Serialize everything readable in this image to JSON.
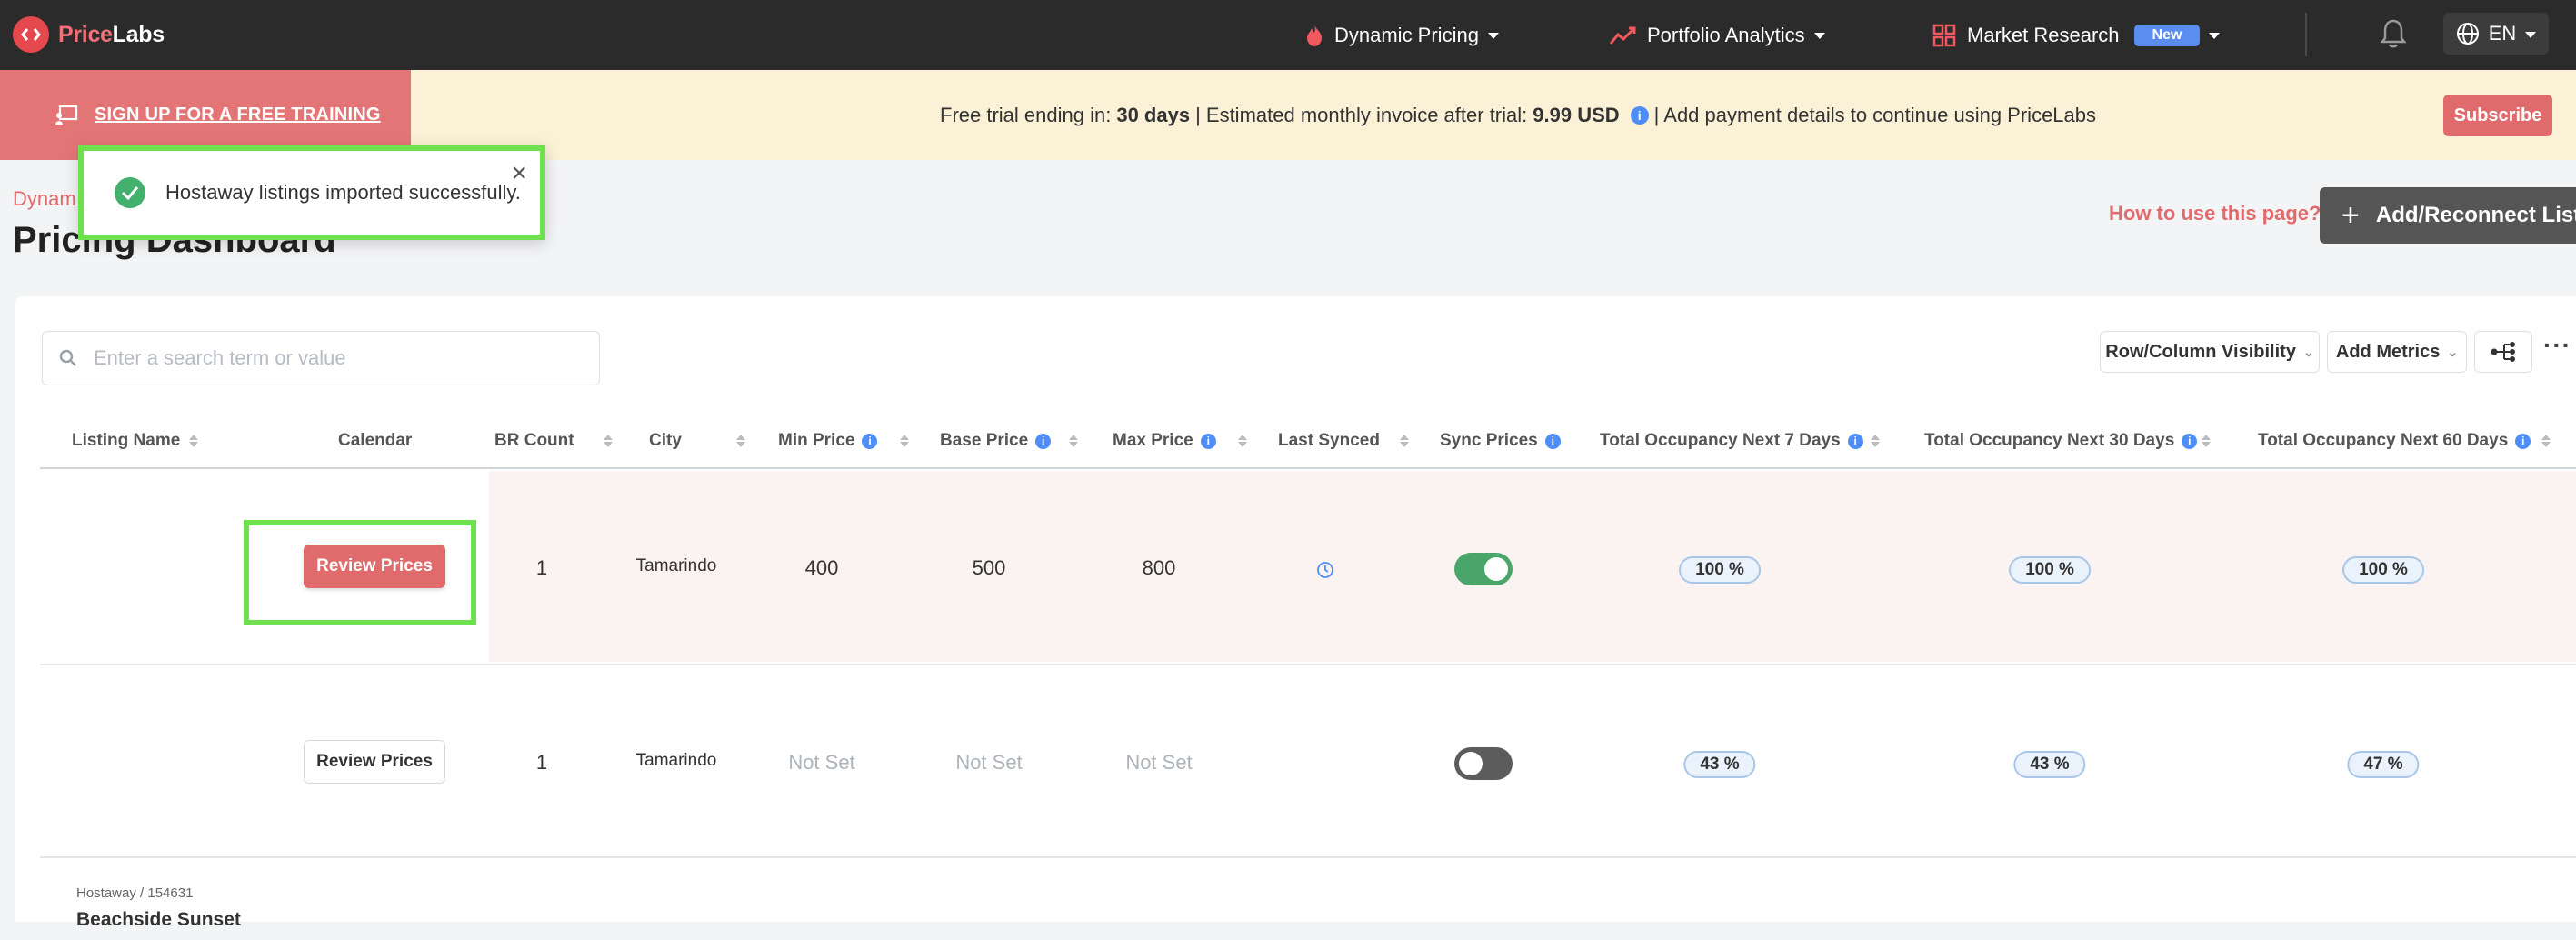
{
  "nav": {
    "logo_part1": "Price",
    "logo_part2": "Labs",
    "items": [
      {
        "label": "Dynamic Pricing"
      },
      {
        "label": "Portfolio Analytics"
      },
      {
        "label": "Market Research",
        "badge": "New"
      }
    ],
    "language": "EN"
  },
  "banner": {
    "training_link": "SIGN UP FOR A FREE TRAINING",
    "trial_prefix": "Free trial ending in:",
    "trial_days": "30 days",
    "invoice_prefix": "| Estimated monthly invoice after trial:",
    "invoice_amount": "9.99 USD",
    "payment_text": "| Add payment details to continue using PriceLabs",
    "subscribe_label": "Subscribe"
  },
  "page": {
    "breadcrumb": "Dynam",
    "title": "Pricing Dashboard",
    "howto_link": "How to use this page?",
    "add_button": "Add/Reconnect Listin"
  },
  "toast": {
    "message": "Hostaway listings imported successfully.",
    "close": "×"
  },
  "toolbar": {
    "search_placeholder": "Enter a search term or value",
    "visibility_label": "Row/Column Visibility",
    "metrics_label": "Add Metrics",
    "more_label": "···"
  },
  "table": {
    "columns": [
      {
        "label": "Listing Name"
      },
      {
        "label": "Calendar"
      },
      {
        "label": "BR Count"
      },
      {
        "label": "City"
      },
      {
        "label": "Min Price"
      },
      {
        "label": "Base Price"
      },
      {
        "label": "Max Price"
      },
      {
        "label": "Last Synced"
      },
      {
        "label": "Sync Prices"
      },
      {
        "label": "Total Occupancy Next 7 Days"
      },
      {
        "label": "Total Occupancy Next 30 Days"
      },
      {
        "label": "Total Occupancy Next 60 Days"
      }
    ],
    "rows": [
      {
        "calendar_button": "Review Prices",
        "br_count": "1",
        "city": "Tamarindo",
        "min_price": "400",
        "base_price": "500",
        "max_price": "800",
        "sync_prices": true,
        "occ7": "100 %",
        "occ30": "100 %",
        "occ60": "100 %"
      },
      {
        "calendar_button": "Review Prices",
        "br_count": "1",
        "city": "Tamarindo",
        "min_price": "Not Set",
        "base_price": "Not Set",
        "max_price": "Not Set",
        "sync_prices": false,
        "occ7": "43 %",
        "occ30": "43 %",
        "occ60": "47 %"
      },
      {
        "source": "Hostaway / 154631",
        "listing_name": "Beachside Sunset"
      }
    ]
  },
  "colors": {
    "brand": "#e06b6d",
    "nav_bg": "#2b2b2b",
    "banner_bg": "#fbf1d6",
    "toggle_on": "#4aa56b",
    "highlight": "#6fe04e",
    "new_badge": "#5b8cf0"
  }
}
